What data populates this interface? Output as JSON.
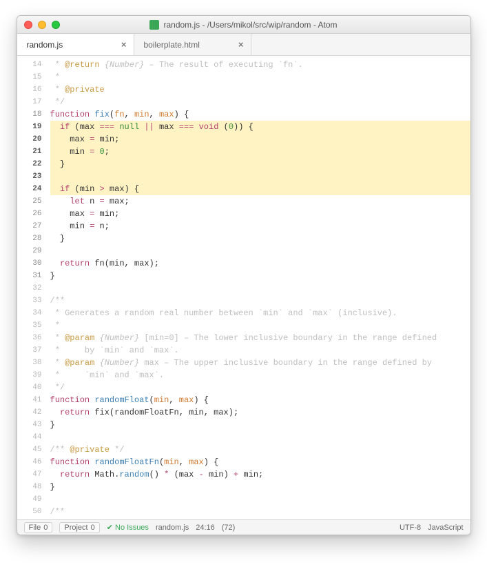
{
  "window": {
    "title": "random.js - /Users/mikol/src/wip/random - Atom"
  },
  "tabs": [
    {
      "label": "random.js",
      "active": true
    },
    {
      "label": "boilerplate.html",
      "active": false
    }
  ],
  "gutter": {
    "start": 14,
    "end": 50,
    "highlighted": [
      19,
      20,
      21,
      22,
      23,
      24
    ],
    "context": [
      18,
      25,
      26,
      27,
      28,
      29,
      30,
      31
    ]
  },
  "code": {
    "lines": [
      {
        "n": 14,
        "frag": [
          {
            "t": " * ",
            "cls": "c-comment"
          },
          {
            "t": "@return",
            "cls": "c-tag"
          },
          {
            "t": " {Number}",
            "cls": "c-type"
          },
          {
            "t": " – The result of executing `fn`.",
            "cls": "c-comment"
          }
        ]
      },
      {
        "n": 15,
        "frag": [
          {
            "t": " *",
            "cls": "c-comment"
          }
        ]
      },
      {
        "n": 16,
        "frag": [
          {
            "t": " * ",
            "cls": "c-comment"
          },
          {
            "t": "@private",
            "cls": "c-tag"
          }
        ]
      },
      {
        "n": 17,
        "frag": [
          {
            "t": " */",
            "cls": "c-comment"
          }
        ]
      },
      {
        "n": 18,
        "frag": [
          {
            "t": "function ",
            "cls": "c-kw"
          },
          {
            "t": "fix",
            "cls": "c-fn"
          },
          {
            "t": "("
          },
          {
            "t": "fn",
            "cls": "c-param"
          },
          {
            "t": ", "
          },
          {
            "t": "min",
            "cls": "c-param"
          },
          {
            "t": ", "
          },
          {
            "t": "max",
            "cls": "c-param"
          },
          {
            "t": ") {"
          }
        ]
      },
      {
        "n": 19,
        "hl": true,
        "frag": [
          {
            "t": "  "
          },
          {
            "t": "if",
            "cls": "c-kw"
          },
          {
            "t": " (max "
          },
          {
            "t": "===",
            "cls": "c-op"
          },
          {
            "t": " "
          },
          {
            "t": "null",
            "cls": "c-null"
          },
          {
            "t": " "
          },
          {
            "t": "||",
            "cls": "c-op"
          },
          {
            "t": " max "
          },
          {
            "t": "===",
            "cls": "c-op"
          },
          {
            "t": " "
          },
          {
            "t": "void",
            "cls": "c-kw"
          },
          {
            "t": " ("
          },
          {
            "t": "0",
            "cls": "c-num"
          },
          {
            "t": ")) {"
          }
        ]
      },
      {
        "n": 20,
        "hl": true,
        "frag": [
          {
            "t": "    max "
          },
          {
            "t": "=",
            "cls": "c-op"
          },
          {
            "t": " min;"
          }
        ]
      },
      {
        "n": 21,
        "hl": true,
        "frag": [
          {
            "t": "    min "
          },
          {
            "t": "=",
            "cls": "c-op"
          },
          {
            "t": " "
          },
          {
            "t": "0",
            "cls": "c-num"
          },
          {
            "t": ";"
          }
        ]
      },
      {
        "n": 22,
        "hl": true,
        "frag": [
          {
            "t": "  }"
          }
        ]
      },
      {
        "n": 23,
        "hl": true,
        "frag": [
          {
            "t": ""
          }
        ]
      },
      {
        "n": 24,
        "hl": true,
        "frag": [
          {
            "t": "  "
          },
          {
            "t": "if",
            "cls": "c-kw"
          },
          {
            "t": " (min "
          },
          {
            "t": ">",
            "cls": "c-op"
          },
          {
            "t": " max) {"
          }
        ]
      },
      {
        "n": 25,
        "frag": [
          {
            "t": "    "
          },
          {
            "t": "let",
            "cls": "c-kw"
          },
          {
            "t": " n "
          },
          {
            "t": "=",
            "cls": "c-op"
          },
          {
            "t": " max;"
          }
        ]
      },
      {
        "n": 26,
        "frag": [
          {
            "t": "    max "
          },
          {
            "t": "=",
            "cls": "c-op"
          },
          {
            "t": " min;"
          }
        ]
      },
      {
        "n": 27,
        "frag": [
          {
            "t": "    min "
          },
          {
            "t": "=",
            "cls": "c-op"
          },
          {
            "t": " n;"
          }
        ]
      },
      {
        "n": 28,
        "frag": [
          {
            "t": "  }"
          }
        ]
      },
      {
        "n": 29,
        "frag": [
          {
            "t": ""
          }
        ]
      },
      {
        "n": 30,
        "frag": [
          {
            "t": "  "
          },
          {
            "t": "return",
            "cls": "c-kw"
          },
          {
            "t": " fn(min, max);"
          }
        ]
      },
      {
        "n": 31,
        "frag": [
          {
            "t": "}"
          }
        ]
      },
      {
        "n": 32,
        "frag": [
          {
            "t": ""
          }
        ]
      },
      {
        "n": 33,
        "frag": [
          {
            "t": "/**",
            "cls": "c-comment"
          }
        ]
      },
      {
        "n": 34,
        "frag": [
          {
            "t": " * Generates a random real number between `min` and `max` (inclusive).",
            "cls": "c-comment"
          }
        ]
      },
      {
        "n": 35,
        "frag": [
          {
            "t": " *",
            "cls": "c-comment"
          }
        ]
      },
      {
        "n": 36,
        "frag": [
          {
            "t": " * ",
            "cls": "c-comment"
          },
          {
            "t": "@param",
            "cls": "c-tag"
          },
          {
            "t": " {Number}",
            "cls": "c-type"
          },
          {
            "t": " [min=0] – The lower inclusive boundary in the range defined",
            "cls": "c-comment"
          }
        ]
      },
      {
        "n": 37,
        "frag": [
          {
            "t": " *     by `min` and `max`.",
            "cls": "c-comment"
          }
        ]
      },
      {
        "n": 38,
        "frag": [
          {
            "t": " * ",
            "cls": "c-comment"
          },
          {
            "t": "@param",
            "cls": "c-tag"
          },
          {
            "t": " {Number}",
            "cls": "c-type"
          },
          {
            "t": " max – The upper inclusive boundary in the range defined by",
            "cls": "c-comment"
          }
        ]
      },
      {
        "n": 39,
        "frag": [
          {
            "t": " *     `min` and `max`.",
            "cls": "c-comment"
          }
        ]
      },
      {
        "n": 40,
        "frag": [
          {
            "t": " */",
            "cls": "c-comment"
          }
        ]
      },
      {
        "n": 41,
        "frag": [
          {
            "t": "function ",
            "cls": "c-kw"
          },
          {
            "t": "randomFloat",
            "cls": "c-fn"
          },
          {
            "t": "("
          },
          {
            "t": "min",
            "cls": "c-param"
          },
          {
            "t": ", "
          },
          {
            "t": "max",
            "cls": "c-param"
          },
          {
            "t": ") {"
          }
        ]
      },
      {
        "n": 42,
        "frag": [
          {
            "t": "  "
          },
          {
            "t": "return",
            "cls": "c-kw"
          },
          {
            "t": " fix(randomFloatFn, min, max);"
          }
        ]
      },
      {
        "n": 43,
        "frag": [
          {
            "t": "}"
          }
        ]
      },
      {
        "n": 44,
        "frag": [
          {
            "t": ""
          }
        ]
      },
      {
        "n": 45,
        "frag": [
          {
            "t": "/** ",
            "cls": "c-comment"
          },
          {
            "t": "@private",
            "cls": "c-tag"
          },
          {
            "t": " */",
            "cls": "c-comment"
          }
        ]
      },
      {
        "n": 46,
        "frag": [
          {
            "t": "function ",
            "cls": "c-kw"
          },
          {
            "t": "randomFloatFn",
            "cls": "c-fn"
          },
          {
            "t": "("
          },
          {
            "t": "min",
            "cls": "c-param"
          },
          {
            "t": ", "
          },
          {
            "t": "max",
            "cls": "c-param"
          },
          {
            "t": ") {"
          }
        ]
      },
      {
        "n": 47,
        "frag": [
          {
            "t": "  "
          },
          {
            "t": "return",
            "cls": "c-kw"
          },
          {
            "t": " Math."
          },
          {
            "t": "random",
            "cls": "c-fn"
          },
          {
            "t": "() "
          },
          {
            "t": "*",
            "cls": "c-op"
          },
          {
            "t": " (max "
          },
          {
            "t": "-",
            "cls": "c-op"
          },
          {
            "t": " min) "
          },
          {
            "t": "+",
            "cls": "c-op"
          },
          {
            "t": " min;"
          }
        ]
      },
      {
        "n": 48,
        "frag": [
          {
            "t": "}"
          }
        ]
      },
      {
        "n": 49,
        "frag": [
          {
            "t": ""
          }
        ]
      },
      {
        "n": 50,
        "frag": [
          {
            "t": "/**",
            "cls": "c-comment"
          }
        ]
      }
    ]
  },
  "status": {
    "file_badge": {
      "label": "File",
      "count": "0"
    },
    "project_badge": {
      "label": "Project",
      "count": "0"
    },
    "issues": "No Issues",
    "filename": "random.js",
    "cursor": "24:16",
    "selection": "(72)",
    "encoding": "UTF-8",
    "language": "JavaScript"
  }
}
